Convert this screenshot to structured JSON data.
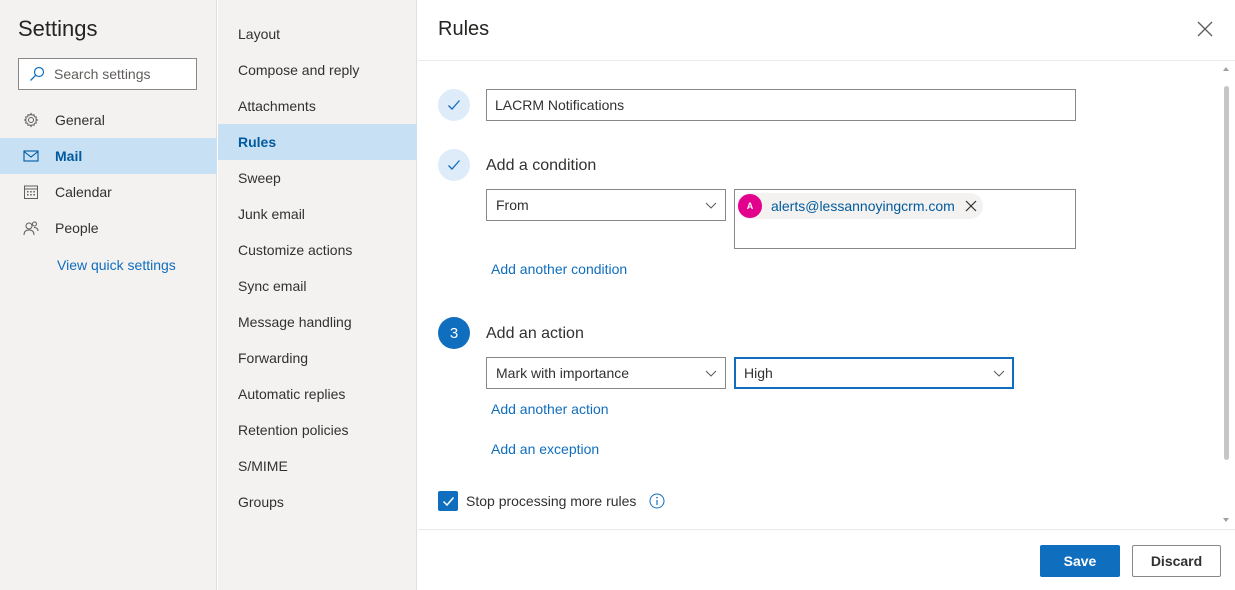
{
  "settings": {
    "title": "Settings",
    "search_placeholder": "Search settings",
    "nav": [
      {
        "label": "General",
        "icon": "gear-icon"
      },
      {
        "label": "Mail",
        "icon": "mail-icon"
      },
      {
        "label": "Calendar",
        "icon": "calendar-icon"
      },
      {
        "label": "People",
        "icon": "people-icon"
      }
    ],
    "active_nav": "Mail",
    "quick_settings_link": "View quick settings"
  },
  "mail_menu": {
    "items": [
      "Layout",
      "Compose and reply",
      "Attachments",
      "Rules",
      "Sweep",
      "Junk email",
      "Customize actions",
      "Sync email",
      "Message handling",
      "Forwarding",
      "Automatic replies",
      "Retention policies",
      "S/MIME",
      "Groups"
    ],
    "active": "Rules"
  },
  "rules": {
    "title": "Rules",
    "rule_name": "LACRM Notifications",
    "condition": {
      "heading": "Add a condition",
      "type": "From",
      "recipient_initial": "A",
      "recipient": "alerts@lessannoyingcrm.com",
      "add_another": "Add another condition"
    },
    "action": {
      "step_number": "3",
      "heading": "Add an action",
      "type": "Mark with importance",
      "value": "High",
      "add_another": "Add another action"
    },
    "add_exception": "Add an exception",
    "stop_processing": {
      "label": "Stop processing more rules",
      "checked": true
    },
    "save_label": "Save",
    "discard_label": "Discard"
  },
  "colors": {
    "accent": "#106ebe",
    "selected_bg": "#c7e0f4",
    "pane_bg": "#f3f2f1",
    "avatar": "#e3008c"
  }
}
